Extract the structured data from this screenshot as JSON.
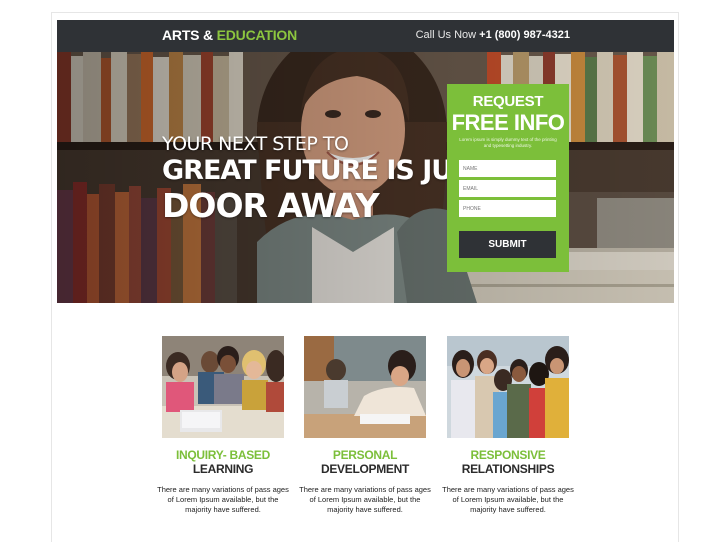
{
  "header": {
    "logo_part1": "ARTS & ",
    "logo_part2": "EDUCATION",
    "phone_prefix": "Call Us Now ",
    "phone_number": "+1 (800) 987-4321"
  },
  "hero": {
    "line1": "YOUR NEXT STEP TO",
    "line2": "GREAT FUTURE IS JUST A",
    "line3": "DOOR AWAY"
  },
  "form": {
    "title1": "REQUEST",
    "title2": "FREE INFO",
    "subtitle": "Lorem ipsum is simply dummy text of the printing and typesetting industry.",
    "name_placeholder": "NAME",
    "email_placeholder": "EMAIL",
    "phone_placeholder": "PHONE",
    "submit_label": "SUBMIT"
  },
  "features": [
    {
      "title_green": "INQUIRY- BASED",
      "title_dark": "LEARNING",
      "description": "There are many variations of pass ages of Lorem Ipsum available, but the majority have suffered."
    },
    {
      "title_green": "PERSONAL",
      "title_dark": "DEVELOPMENT",
      "description": "There are many variations of pass ages of Lorem Ipsum available, but the majority have suffered."
    },
    {
      "title_green": "RESPONSIVE",
      "title_dark": "RELATIONSHIPS",
      "description": "There are many variations of pass ages of Lorem Ipsum available, but the majority have suffered."
    }
  ],
  "colors": {
    "accent_green": "#7cbf3a",
    "header_dark": "#2f3236"
  }
}
